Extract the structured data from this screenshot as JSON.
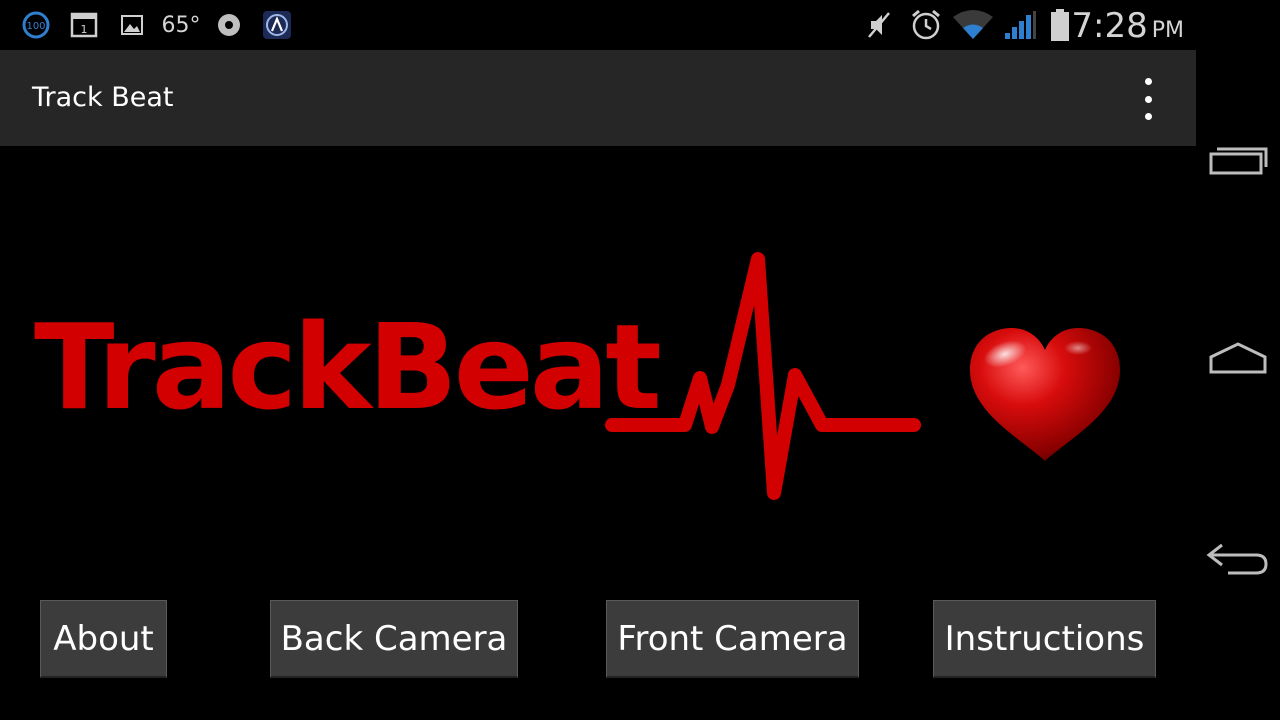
{
  "status_bar": {
    "badge_100": "100",
    "calendar_day": "1",
    "temperature": "65°",
    "time": "7:28",
    "ampm": "PM"
  },
  "action_bar": {
    "title": "Track Beat"
  },
  "logo": {
    "text": "TrackBeat"
  },
  "buttons": {
    "about": "About",
    "back_camera": "Back Camera",
    "front_camera": "Front Camera",
    "instructions": "Instructions"
  },
  "colors": {
    "brand_red": "#d20000",
    "action_bar": "#262626",
    "button_bg": "#3c3c3c"
  }
}
